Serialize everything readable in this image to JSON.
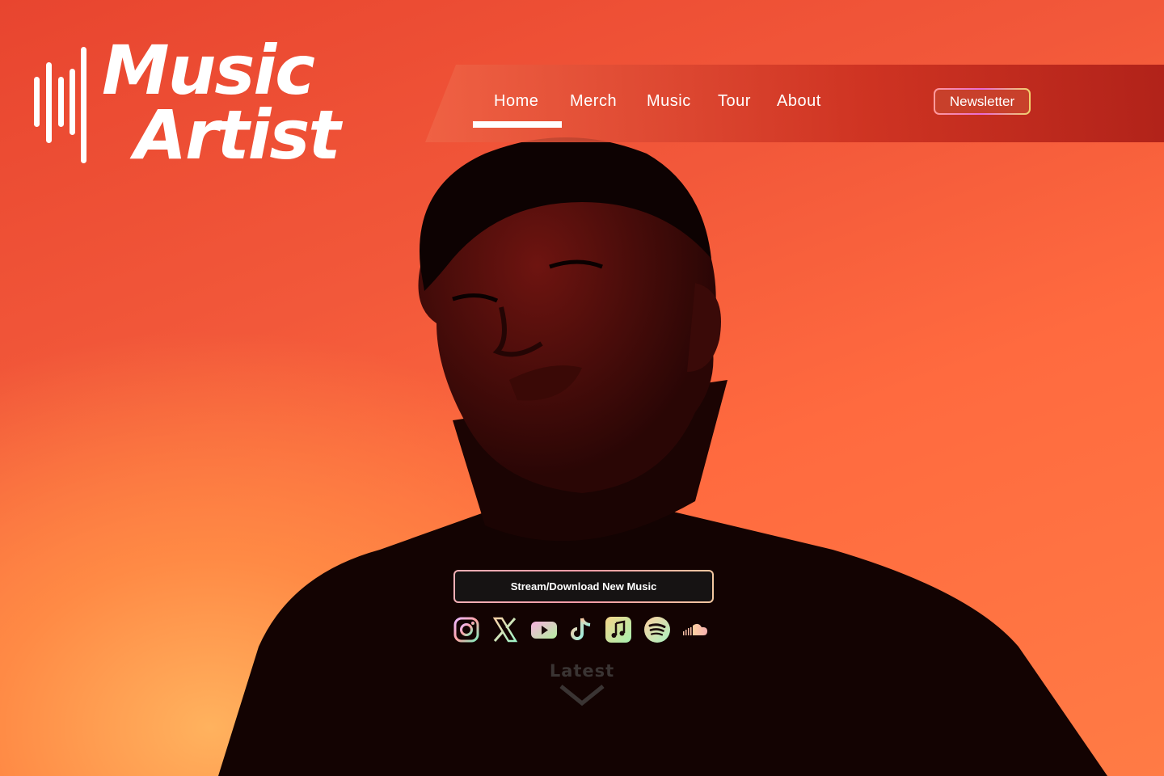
{
  "logo": {
    "line1": "Music",
    "line2": "Artist"
  },
  "nav": {
    "items": [
      {
        "label": "Home",
        "active": true
      },
      {
        "label": "Merch",
        "active": false
      },
      {
        "label": "Music",
        "active": false
      },
      {
        "label": "Tour",
        "active": false
      },
      {
        "label": "About",
        "active": false
      }
    ],
    "newsletter_label": "Newsletter"
  },
  "hero": {
    "cta_label": "Stream/Download New Music",
    "socials": [
      "instagram-icon",
      "x-icon",
      "youtube-icon",
      "tiktok-icon",
      "apple-music-icon",
      "spotify-icon",
      "soundcloud-icon"
    ],
    "latest_label": "Latest"
  },
  "colors": {
    "accent": "#ff6a3f",
    "panel": "#c8402b",
    "dark": "#161313"
  }
}
